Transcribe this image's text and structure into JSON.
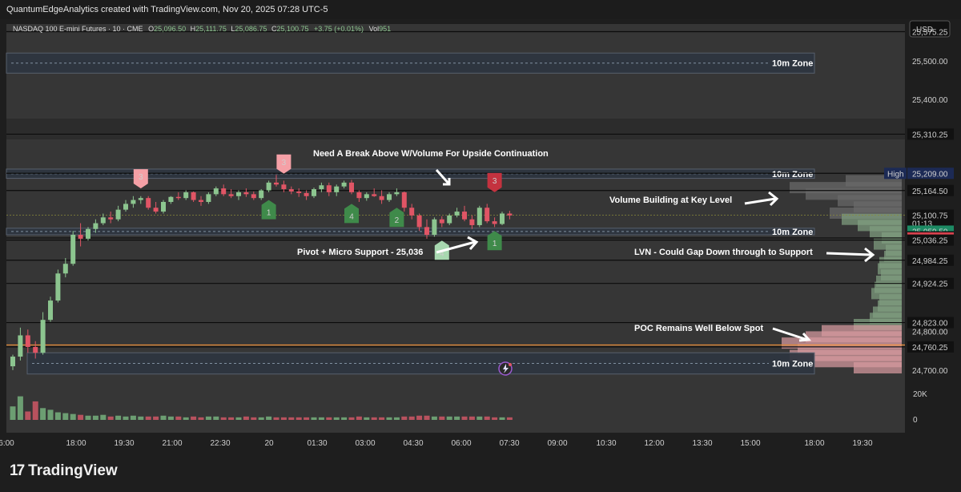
{
  "topbar": {
    "credit": "QuantumEdgeAnalytics created with TradingView.com, Nov 20, 2025 07:28 UTC-5"
  },
  "legend": {
    "symbol": "NASDAQ 100 E-mini Futures · 10 · CME",
    "open_label": "O",
    "open": "25,096.50",
    "high_label": "H",
    "high": "25,111.75",
    "low_label": "L",
    "low": "25,086.75",
    "close_label": "C",
    "close": "25,100.75",
    "change": "+3.75 (+0.01%)",
    "vol_label": "Vol",
    "vol": "951"
  },
  "currency": "USD",
  "brand": {
    "name": "TradingView"
  },
  "colors": {
    "up": "#8cc58f",
    "down": "#e05565",
    "zone": "#2e3540",
    "poc": "#e08a3a",
    "bg": "#363636"
  },
  "chart_data": {
    "type": "candlestick",
    "x_ticks": [
      "6:00",
      "18:00",
      "19:30",
      "21:00",
      "22:30",
      "20",
      "01:30",
      "03:00",
      "04:30",
      "06:00",
      "07:30",
      "09:00",
      "10:30",
      "12:00",
      "13:30",
      "15:00",
      "18:00",
      "19:30"
    ],
    "y_ticks": [
      "25,575.25",
      "25,500.00",
      "25,400.00",
      "25,310.25",
      "25,164.50",
      "25,100.75",
      "25,059.50",
      "25,044.75",
      "25,041.75",
      "25,036.25",
      "24,984.25",
      "24,924.25",
      "24,823.00",
      "24,800.00",
      "24,760.25",
      "24,700.00"
    ],
    "ylim": [
      24675,
      25595
    ],
    "level_lines": [
      25575.25,
      25310.25,
      25209.0,
      25164.5,
      25041.75,
      25036.25,
      24984.25,
      24924.25,
      24823.0,
      24760.25
    ],
    "price_labels": [
      {
        "text": "25,310.25",
        "value": 25310.25,
        "style": "dark"
      },
      {
        "text": "25,209.00",
        "value": 25209.0,
        "style": "navy",
        "tag": "High"
      },
      {
        "text": "25,164.50",
        "value": 25164.5,
        "style": "dark"
      },
      {
        "text": "25,100.75",
        "value": 25100.75,
        "style": "dark",
        "sub": "01:13"
      },
      {
        "text": "25,059.50",
        "value": 25059.5,
        "style": "green"
      },
      {
        "text": "25,044.75",
        "value": 25044.75,
        "style": "dark"
      },
      {
        "text": "25,041.75",
        "value": 25041.75,
        "style": "red"
      },
      {
        "text": "25,036.25",
        "value": 25036.25,
        "style": "dark"
      },
      {
        "text": "24,984.25",
        "value": 24984.25,
        "style": "dark"
      },
      {
        "text": "24,924.25",
        "value": 24924.25,
        "style": "dark"
      },
      {
        "text": "24,823.00",
        "value": 24823.0,
        "style": "dark"
      },
      {
        "text": "24,760.25",
        "value": 24760.25,
        "style": "dark"
      }
    ],
    "zones": [
      {
        "label": "10m Zone",
        "top": 25520,
        "bottom": 25468
      },
      {
        "label": "10m Zone",
        "top": 25220,
        "bottom": 25196
      },
      {
        "label": "10m Zone",
        "top": 25067,
        "bottom": 25050
      },
      {
        "label": "10m Zone",
        "top": 24745,
        "bottom": 24690
      }
    ],
    "poc": 24765,
    "candles": [
      [
        24710,
        24740,
        24700,
        24735
      ],
      [
        24735,
        24810,
        24725,
        24790
      ],
      [
        24790,
        24805,
        24745,
        24760
      ],
      [
        24760,
        24775,
        24730,
        24745
      ],
      [
        24745,
        24850,
        24740,
        24830
      ],
      [
        24830,
        24890,
        24825,
        24880
      ],
      [
        24880,
        24960,
        24875,
        24950
      ],
      [
        24950,
        24990,
        24940,
        24975
      ],
      [
        24975,
        25060,
        24970,
        25050
      ],
      [
        25050,
        25080,
        25020,
        25040
      ],
      [
        25040,
        25070,
        25035,
        25065
      ],
      [
        25065,
        25090,
        25055,
        25080
      ],
      [
        25080,
        25105,
        25075,
        25095
      ],
      [
        25095,
        25110,
        25080,
        25090
      ],
      [
        25090,
        25125,
        25085,
        25115
      ],
      [
        25115,
        25140,
        25110,
        25130
      ],
      [
        25130,
        25150,
        25120,
        25140
      ],
      [
        25140,
        25150,
        25130,
        25145
      ],
      [
        25145,
        25150,
        25115,
        25120
      ],
      [
        25120,
        25135,
        25105,
        25110
      ],
      [
        25110,
        25140,
        25105,
        25135
      ],
      [
        25135,
        25150,
        25130,
        25148
      ],
      [
        25148,
        25160,
        25140,
        25145
      ],
      [
        25145,
        25165,
        25140,
        25160
      ],
      [
        25160,
        25162,
        25135,
        25140
      ],
      [
        25140,
        25150,
        25125,
        25135
      ],
      [
        25135,
        25160,
        25130,
        25155
      ],
      [
        25155,
        25175,
        25150,
        25170
      ],
      [
        25170,
        25180,
        25150,
        25155
      ],
      [
        25155,
        25168,
        25145,
        25150
      ],
      [
        25150,
        25165,
        25140,
        25160
      ],
      [
        25160,
        25170,
        25148,
        25155
      ],
      [
        25155,
        25162,
        25140,
        25145
      ],
      [
        25145,
        25168,
        25140,
        25165
      ],
      [
        25165,
        25190,
        25160,
        25185
      ],
      [
        25185,
        25205,
        25175,
        25180
      ],
      [
        25180,
        25190,
        25160,
        25168
      ],
      [
        25168,
        25175,
        25155,
        25162
      ],
      [
        25162,
        25170,
        25148,
        25158
      ],
      [
        25158,
        25165,
        25140,
        25150
      ],
      [
        25150,
        25172,
        25145,
        25168
      ],
      [
        25168,
        25185,
        25160,
        25178
      ],
      [
        25178,
        25185,
        25150,
        25160
      ],
      [
        25160,
        25180,
        25150,
        25175
      ],
      [
        25175,
        25190,
        25170,
        25185
      ],
      [
        25185,
        25192,
        25155,
        25160
      ],
      [
        25160,
        25165,
        25135,
        25145
      ],
      [
        25145,
        25160,
        25138,
        25155
      ],
      [
        25155,
        25170,
        25148,
        25150
      ],
      [
        25150,
        25165,
        25130,
        25140
      ],
      [
        25140,
        25160,
        25135,
        25155
      ],
      [
        25155,
        25170,
        25150,
        25160
      ],
      [
        25160,
        25162,
        25110,
        25120
      ],
      [
        25120,
        25130,
        25090,
        25100
      ],
      [
        25100,
        25105,
        25060,
        25070
      ],
      [
        25070,
        25090,
        25040,
        25050
      ],
      [
        25050,
        25095,
        25045,
        25090
      ],
      [
        25090,
        25098,
        25070,
        25080
      ],
      [
        25080,
        25105,
        25075,
        25100
      ],
      [
        25100,
        25120,
        25095,
        25110
      ],
      [
        25110,
        25125,
        25085,
        25090
      ],
      [
        25090,
        25100,
        25065,
        25075
      ],
      [
        25075,
        25125,
        25070,
        25120
      ],
      [
        25120,
        25130,
        25080,
        25085
      ],
      [
        25085,
        25095,
        25070,
        25078
      ],
      [
        25078,
        25110,
        25075,
        25105
      ],
      [
        25105,
        25112,
        25090,
        25100
      ]
    ],
    "volume": [
      16,
      28,
      10,
      22,
      14,
      12,
      9,
      8,
      7,
      6,
      5,
      5,
      6,
      4,
      5,
      4,
      5,
      4,
      4,
      4,
      5,
      4,
      4,
      3,
      4,
      3,
      4,
      4,
      3,
      3,
      3,
      4,
      3,
      3,
      4,
      3,
      3,
      3,
      3,
      3,
      3,
      3,
      3,
      3,
      3,
      3,
      4,
      3,
      3,
      3,
      3,
      3,
      4,
      4,
      5,
      5,
      4,
      4,
      4,
      4,
      4,
      4,
      4,
      4,
      3,
      3,
      3
    ],
    "volume_axis": [
      "20K",
      "0"
    ],
    "profile_rows": [
      {
        "price": 25190,
        "len": 70,
        "tone": "gray"
      },
      {
        "price": 25172,
        "len": 140,
        "tone": "gray"
      },
      {
        "price": 25155,
        "len": 120,
        "tone": "gray"
      },
      {
        "price": 25138,
        "len": 80,
        "tone": "gray"
      },
      {
        "price": 25122,
        "len": 60,
        "tone": "gray"
      },
      {
        "price": 25106,
        "len": 90,
        "tone": "gray"
      },
      {
        "price": 25090,
        "len": 75,
        "tone": "green"
      },
      {
        "price": 25074,
        "len": 55,
        "tone": "green"
      },
      {
        "price": 25058,
        "len": 40,
        "tone": "green"
      },
      {
        "price": 25042,
        "len": 25,
        "tone": "green"
      },
      {
        "price": 25026,
        "len": 35,
        "tone": "green"
      },
      {
        "price": 25010,
        "len": 20,
        "tone": "green"
      },
      {
        "price": 24994,
        "len": 22,
        "tone": "green"
      },
      {
        "price": 24978,
        "len": 28,
        "tone": "green"
      },
      {
        "price": 24962,
        "len": 30,
        "tone": "green"
      },
      {
        "price": 24946,
        "len": 26,
        "tone": "green"
      },
      {
        "price": 24930,
        "len": 32,
        "tone": "green"
      },
      {
        "price": 24914,
        "len": 34,
        "tone": "green"
      },
      {
        "price": 24898,
        "len": 38,
        "tone": "green"
      },
      {
        "price": 24882,
        "len": 28,
        "tone": "green"
      },
      {
        "price": 24866,
        "len": 30,
        "tone": "green"
      },
      {
        "price": 24850,
        "len": 36,
        "tone": "green"
      },
      {
        "price": 24834,
        "len": 40,
        "tone": "green"
      },
      {
        "price": 24818,
        "len": 60,
        "tone": "green"
      },
      {
        "price": 24802,
        "len": 100,
        "tone": "red"
      },
      {
        "price": 24786,
        "len": 120,
        "tone": "red"
      },
      {
        "price": 24770,
        "len": 150,
        "tone": "red"
      },
      {
        "price": 24754,
        "len": 130,
        "tone": "red"
      },
      {
        "price": 24738,
        "len": 140,
        "tone": "red"
      },
      {
        "price": 24722,
        "len": 110,
        "tone": "red"
      },
      {
        "price": 24706,
        "len": 60,
        "tone": "red"
      }
    ],
    "markers": [
      {
        "text": "3",
        "bar": 17,
        "value": 25170,
        "style": "pink",
        "dir": "down"
      },
      {
        "text": "3",
        "bar": 36,
        "value": 25208,
        "style": "pink",
        "dir": "down"
      },
      {
        "text": "1",
        "bar": 34,
        "value": 25140,
        "style": "green",
        "dir": "up"
      },
      {
        "text": "4",
        "bar": 45,
        "value": 25130,
        "style": "green",
        "dir": "up"
      },
      {
        "text": "2",
        "bar": 51,
        "value": 25120,
        "style": "green",
        "dir": "up"
      },
      {
        "text": "3",
        "bar": 64,
        "value": 25160,
        "style": "red",
        "dir": "down"
      },
      {
        "text": "4",
        "bar": 57,
        "value": 25035,
        "style": "lightgreen",
        "dir": "up"
      },
      {
        "text": "1",
        "bar": 64,
        "value": 25060,
        "style": "green",
        "dir": "up"
      }
    ],
    "annotations": [
      {
        "text": "Need A Break Above W/Volume For Upside Continuation"
      },
      {
        "text": "Volume Building at Key Level"
      },
      {
        "text": "Pivot + Micro Support - 25,036"
      },
      {
        "text": "LVN - Could Gap Down through to Support"
      },
      {
        "text": "POC Remains Well Below Spot"
      }
    ]
  }
}
